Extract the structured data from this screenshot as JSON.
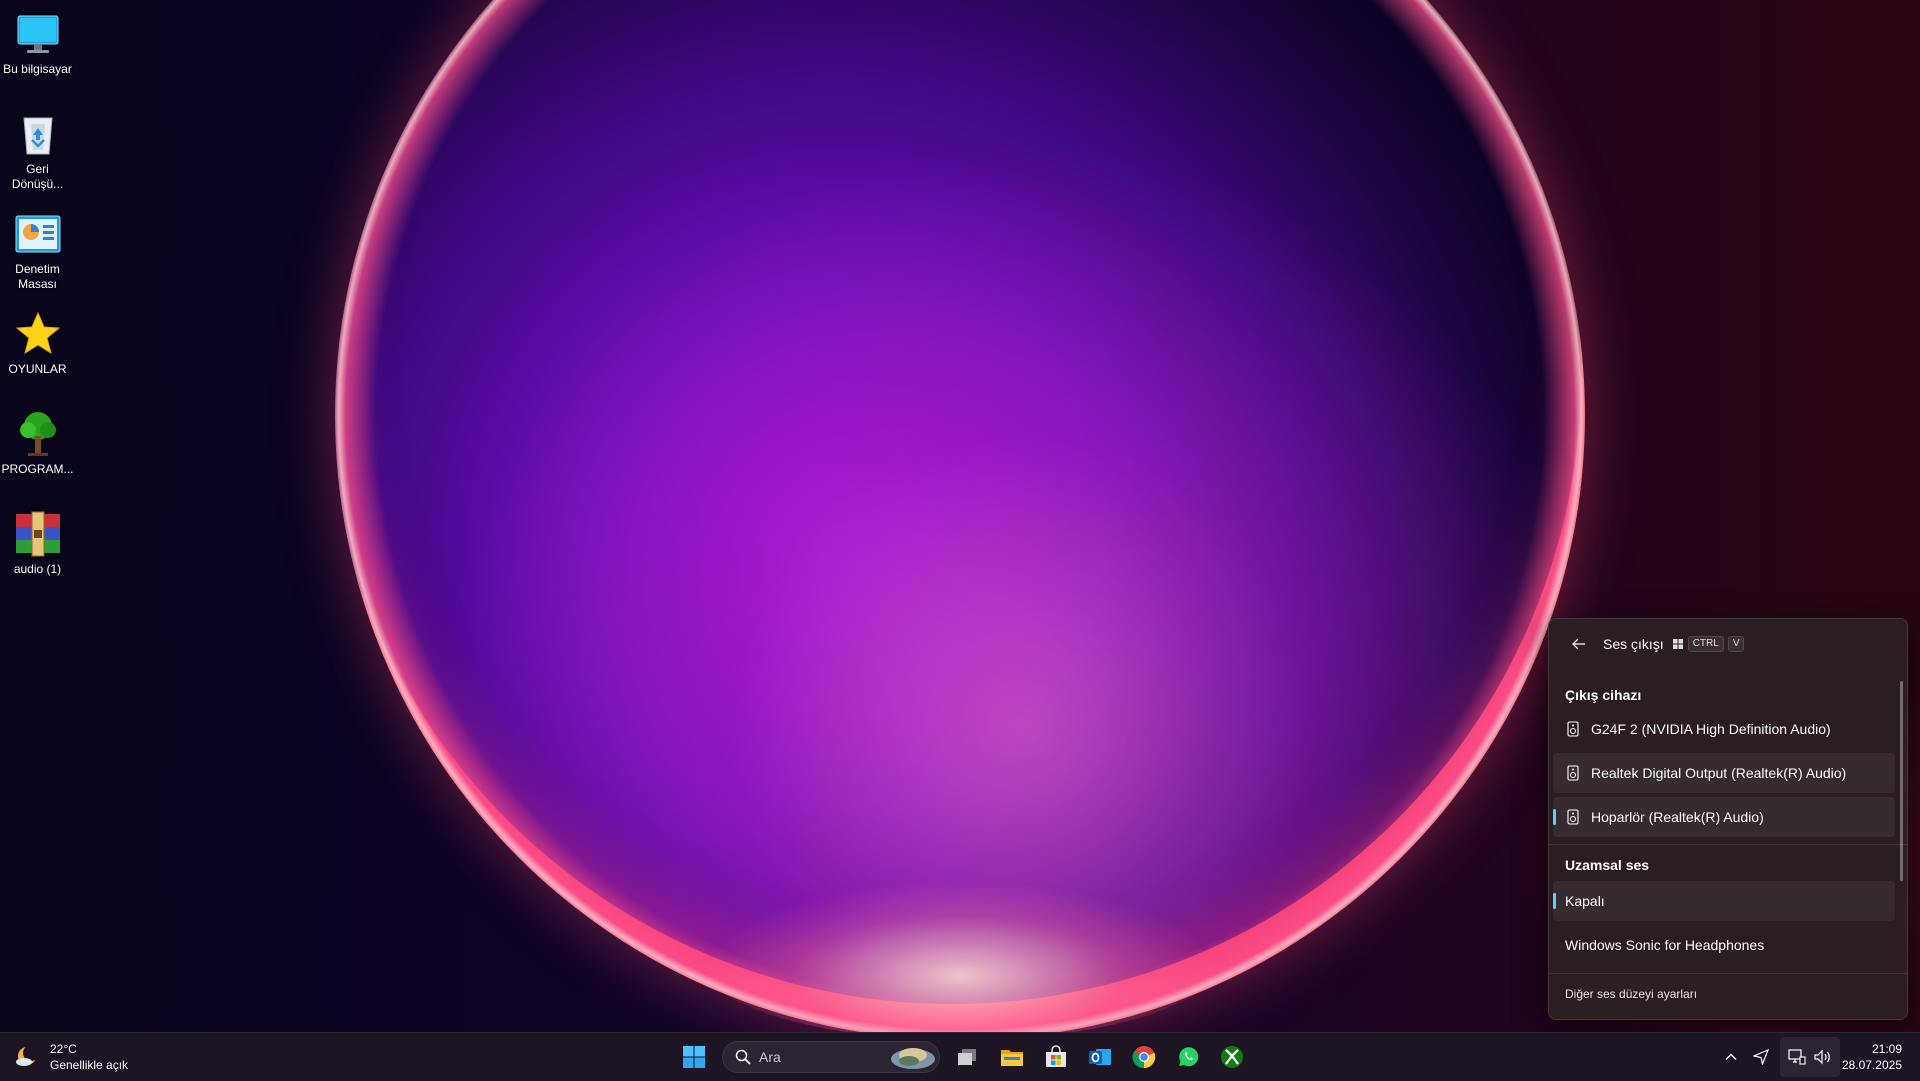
{
  "desktop": {
    "icons": [
      {
        "label": "Bu bilgisayar",
        "icon": "monitor-icon"
      },
      {
        "label": "Geri Dönüşü...",
        "icon": "recycle-bin-icon"
      },
      {
        "label": "Denetim Masası",
        "icon": "control-panel-icon"
      },
      {
        "label": "OYUNLAR",
        "icon": "star-icon"
      },
      {
        "label": "PROGRAM...",
        "icon": "tree-icon"
      },
      {
        "label": "audio (1)",
        "icon": "winrar-archive-icon"
      }
    ]
  },
  "taskbar": {
    "weather": {
      "temp": "22°C",
      "condition": "Genellikle açık",
      "icon": "weather-moon-cloud-icon"
    },
    "search": {
      "placeholder": "Ara"
    },
    "apps": [
      "start-icon",
      "task-view-icon",
      "file-explorer-icon",
      "microsoft-store-icon",
      "outlook-icon",
      "chrome-icon",
      "whatsapp-icon",
      "xbox-icon"
    ],
    "tray": {
      "icons": [
        "chevron-up-icon",
        "location-icon",
        "network-icon",
        "volume-icon"
      ]
    },
    "clock": {
      "time": "21:09",
      "date": "28.07.2025"
    }
  },
  "flyout": {
    "title": "Ses çıkışı",
    "shortcut": [
      "CTRL",
      "V"
    ],
    "output_section": "Çıkış cihazı",
    "devices": [
      {
        "label": "G24F 2 (NVIDIA High Definition Audio)",
        "selected": false
      },
      {
        "label": "Realtek Digital Output (Realtek(R) Audio)",
        "selected": false
      },
      {
        "label": "Hoparlör (Realtek(R) Audio)",
        "selected": true
      }
    ],
    "spatial_section": "Uzamsal ses",
    "spatial_options": [
      {
        "label": "Kapalı",
        "selected": true
      },
      {
        "label": "Windows Sonic for Headphones",
        "selected": false
      }
    ],
    "footer": "Diğer ses düzeyi ayarları",
    "accent": "#60cdff"
  }
}
